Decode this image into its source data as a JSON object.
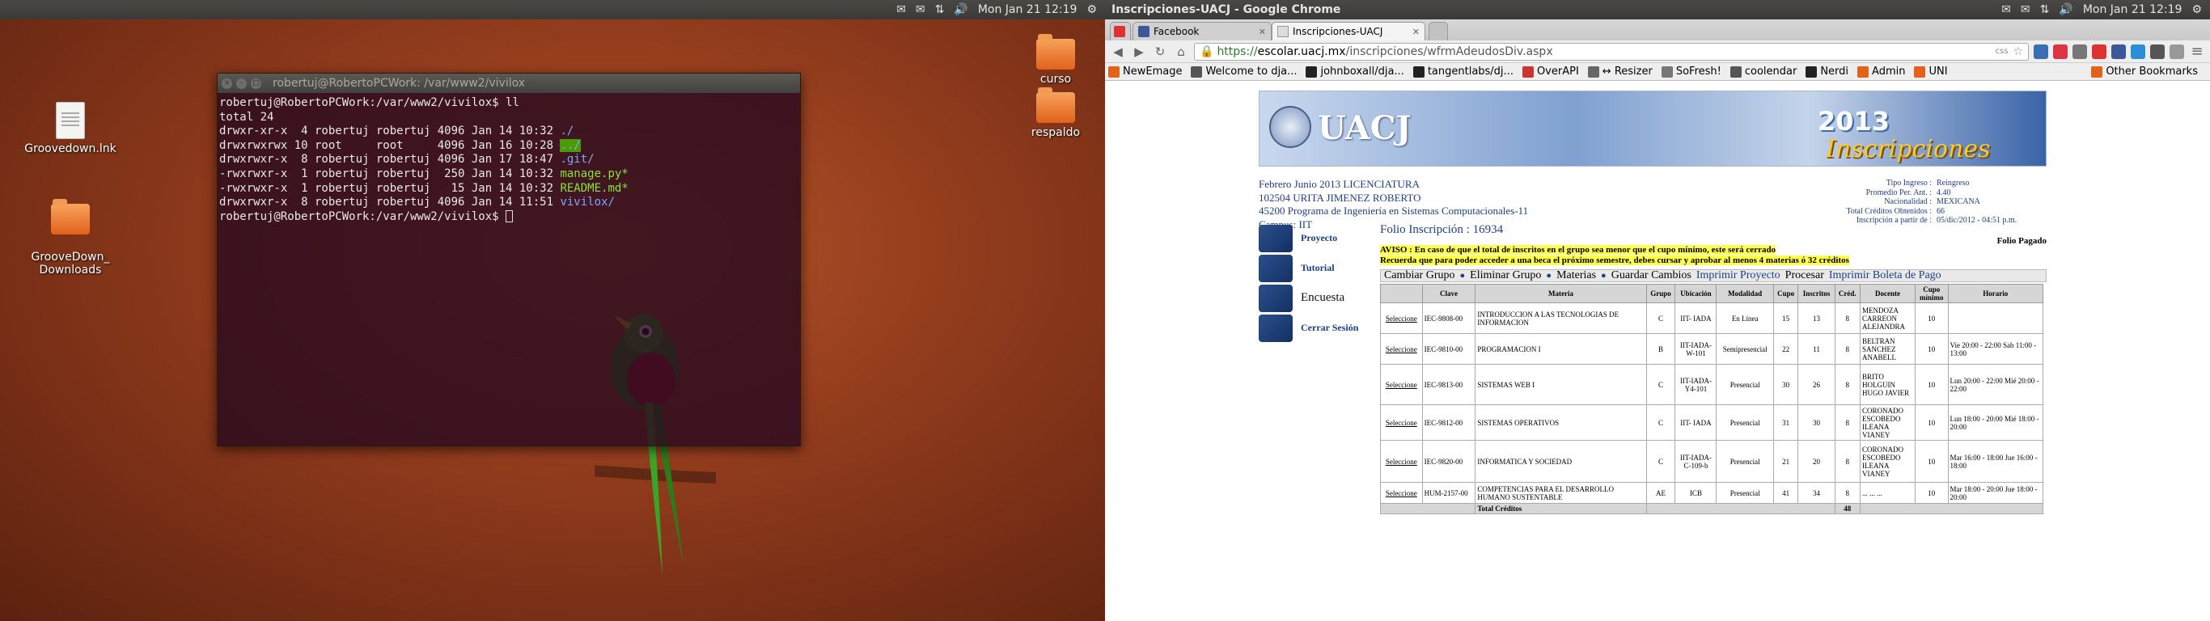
{
  "monitor1": {
    "panel": {
      "date_time": "Mon Jan 21 12:19"
    },
    "desktop_icons": [
      {
        "label": "Groovedown.lnk"
      },
      {
        "label": "GrooveDown_\nDownloads"
      },
      {
        "label": "curso"
      },
      {
        "label": "respaldo"
      }
    ],
    "terminal": {
      "title": "robertuj@RobertoPCWork: /var/www2/vivilox",
      "prompt": "robertuj@RobertoPCWork:/var/www2/vivilox$ ",
      "command": "ll",
      "total": "total 24",
      "rows": [
        {
          "meta": "drwxr-xr-x  4 robertuj robertuj 4096 Jan 14 10:32 ",
          "name": "./",
          "kind": "dir"
        },
        {
          "meta": "drwxrwxrwx 10 root     root     4096 Jan 16 10:28 ",
          "name": "../",
          "kind": "hl"
        },
        {
          "meta": "drwxrwxr-x  8 robertuj robertuj 4096 Jan 17 18:47 ",
          "name": ".git/",
          "kind": "dir"
        },
        {
          "meta": "-rwxrwxr-x  1 robertuj robertuj  250 Jan 14 10:32 ",
          "name": "manage.py*",
          "kind": "exe"
        },
        {
          "meta": "-rwxrwxr-x  1 robertuj robertuj   15 Jan 14 10:32 ",
          "name": "README.md*",
          "kind": "exe"
        },
        {
          "meta": "drwxrwxr-x  8 robertuj robertuj 4096 Jan 14 11:51 ",
          "name": "vivilox/",
          "kind": "dir"
        }
      ]
    }
  },
  "monitor2": {
    "panel": {
      "window_title": "Inscripciones-UACJ - Google Chrome",
      "date_time": "Mon Jan 21 12:19"
    },
    "tabs": [
      {
        "label": "Facebook",
        "active": false
      },
      {
        "label": "Inscripciones-UACJ",
        "active": true
      }
    ],
    "url_https": "https://",
    "url_host": "escolar.uacj.mx",
    "url_path": "/inscripciones/wfrmAdeudosDiv.aspx",
    "bookmarks": [
      "NewEmage",
      "Welcome to dja...",
      "johnboxall/dja...",
      "tangentlabs/dj...",
      "OverAPI",
      "↔ Resizer",
      "SoFresh!",
      "coolendar",
      "Nerdi",
      "Admin",
      "UNI"
    ],
    "other_bookmarks": "Other Bookmarks",
    "page": {
      "logo_text": "UACJ",
      "banner_year": "2013",
      "banner_word": "Inscripciones",
      "student_lines": [
        "Febrero Junio 2013 LICENCIATURA",
        "102504 URITA JIMENEZ ROBERTO",
        "45200 Programa de Ingeniería en Sistemas Computacionales-11",
        "Campus: IIT"
      ],
      "right_info": [
        {
          "k": "Tipo Ingreso :",
          "v": "Reingreso"
        },
        {
          "k": "Promedio Per. Ant. :",
          "v": "4.40"
        },
        {
          "k": "Nacionalidad :",
          "v": "MEXICANA"
        },
        {
          "k": "Total Créditos Obtenidos :",
          "v": "66"
        },
        {
          "k": "Inscripción a partir de :",
          "v": "05/dic/2012 - 04:51 p.m."
        }
      ],
      "sidebar": [
        {
          "label": "Proyecto"
        },
        {
          "label": "Tutorial"
        },
        {
          "label": "Encuesta"
        },
        {
          "label": "Cerrar Sesión"
        }
      ],
      "folio": "Folio Inscripción : 16934",
      "folio_status": "Folio Pagado",
      "aviso_1": "AVISO : En caso de que el total de inscritos en el grupo sea menor que el cupo mínimo, este será cerrado",
      "aviso_2": "Recuerda que para poder acceder a una beca el próximo semestre, debes cursar y aprobar al menos 4 materias ó 32 créditos",
      "actions": [
        "Cambiar Grupo",
        "Eliminar Grupo",
        "Materias",
        "Guardar Cambios",
        "Imprimir Proyecto",
        "Procesar",
        "Imprimir Boleta de Pago"
      ],
      "table_headers": [
        "",
        "Clave",
        "Materia",
        "Grupo",
        "Ubicación",
        "Modalidad",
        "Cupo",
        "Inscritos",
        "Créd.",
        "Docente",
        "Cupo mínimo",
        "Horario"
      ],
      "rows": [
        [
          "Seleccione",
          "IEC-9808-00",
          "INTRODUCCION A LAS TECNOLOGIAS DE INFORMACION",
          "C",
          "IIT- IADA",
          "En Línea",
          "15",
          "13",
          "8",
          "MENDOZA CARREON ALEJANDRA",
          "10",
          ""
        ],
        [
          "Seleccione",
          "IEC-9810-00",
          "PROGRAMACION I",
          "B",
          "IIT-IADA-W-101",
          "Semipresencial",
          "22",
          "11",
          "8",
          "BELTRAN SANCHEZ ANABELL",
          "10",
          "Vie 20:00 - 22:00 Sab 11:00 - 13:00"
        ],
        [
          "Seleccione",
          "IEC-9813-00",
          "SISTEMAS WEB I",
          "C",
          "IIT-IADA-Y4-101",
          "Presencial",
          "30",
          "26",
          "8",
          "BRITO HOLGUIN HUGO JAVIER",
          "10",
          "Lun 20:00 - 22:00 Mié 20:00 - 22:00"
        ],
        [
          "Seleccione",
          "IEC-9812-00",
          "SISTEMAS OPERATIVOS",
          "C",
          "IIT- IADA",
          "Presencial",
          "31",
          "30",
          "8",
          "CORONADO ESCOBEDO ILEANA VIANEY",
          "10",
          "Lun 18:00 - 20:00 Mié 18:00 - 20:00"
        ],
        [
          "Seleccione",
          "IEC-9820-00",
          "INFORMATICA Y SOCIEDAD",
          "C",
          "IIT-IADA-C-109-b",
          "Presencial",
          "21",
          "20",
          "8",
          "CORONADO ESCOBEDO ILEANA VIANEY",
          "10",
          "Mar 16:00 - 18:00 Jue 16:00 - 18:00"
        ],
        [
          "Seleccione",
          "HUM-2157-00",
          "COMPETENCIAS PARA EL DESARROLLO HUMANO SUSTENTABLE",
          "AE",
          "ICB",
          "Presencial",
          "41",
          "34",
          "8",
          "... ... ...",
          "10",
          "Mar 18:00 - 20:00 Jue 18:00 - 20:00"
        ]
      ],
      "total_label": "Total Créditos",
      "total_value": "48"
    }
  },
  "colors": {
    "terminal_bg": "#2a0a1e",
    "link_blue": "#1f3d8a",
    "aviso_highlight": "#ffff4d"
  }
}
